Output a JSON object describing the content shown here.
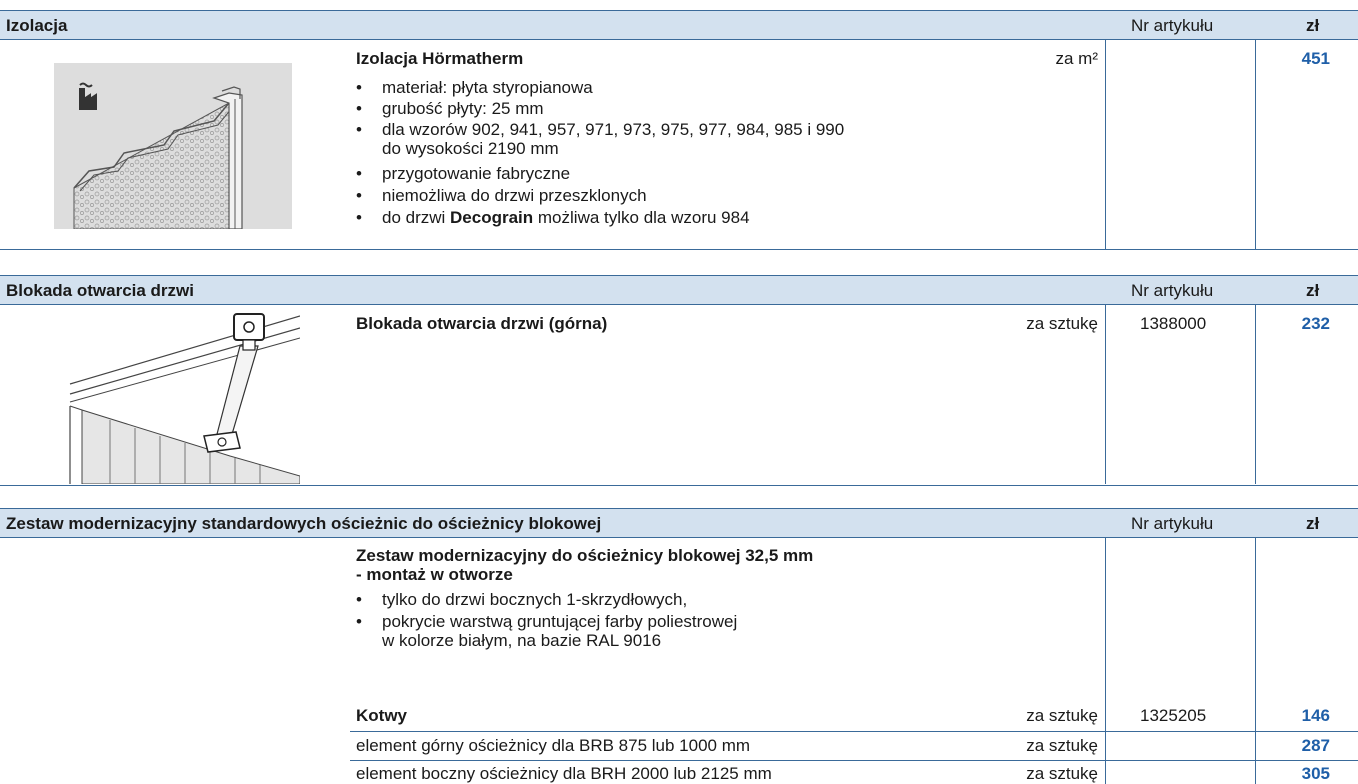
{
  "sections": [
    {
      "title": "Izolacja",
      "col_nr": "Nr artykułu",
      "col_price": "zł",
      "product": "Izolacja Hörmatherm",
      "unit": "za m²",
      "article": "",
      "price": "451",
      "bullets": [
        "materiał: płyta styropianowa",
        "grubość płyty: 25 mm",
        "dla wzorów 902, 941, 957, 971, 973, 975, 977, 984, 985 i 990",
        "przygotowanie fabryczne",
        "niemożliwa do drzwi przeszklonych"
      ],
      "bullet3_cont": "do wysokości 2190 mm",
      "last_bullet_pre": "do drzwi ",
      "last_bullet_bold": "Decograin",
      "last_bullet_post": " możliwa tylko dla wzoru 984"
    },
    {
      "title": "Blokada otwarcia drzwi",
      "col_nr": "Nr artykułu",
      "col_price": "zł",
      "product": "Blokada otwarcia drzwi (górna)",
      "unit": "za sztukę",
      "article": "1388000",
      "price": "232"
    },
    {
      "title": "Zestaw modernizacyjny standardowych ościeżnic do ościeżnicy blokowej",
      "col_nr": "Nr artykułu",
      "col_price": "zł",
      "product_line1": "Zestaw modernizacyjny do ościeżnicy blokowej 32,5 mm",
      "product_line2": "- montaż w otworze",
      "bullets": [
        "tylko do drzwi bocznych 1-skrzydłowych,",
        "pokrycie warstwą gruntującej farby poliestrowej"
      ],
      "bullet2_cont": "w kolorze białym, na bazie RAL 9016",
      "rows": [
        {
          "label": "Kotwy",
          "unit": "za sztukę",
          "article": "1325205",
          "price": "146"
        },
        {
          "label": "element górny ościeżnicy dla BRB 875 lub 1000 mm",
          "unit": "za sztukę",
          "article": "",
          "price": "287"
        },
        {
          "label": "element boczny ościeżnicy dla BRH 2000 lub 2125 mm",
          "unit": "za sztukę",
          "article": "",
          "price": "305"
        }
      ]
    }
  ]
}
